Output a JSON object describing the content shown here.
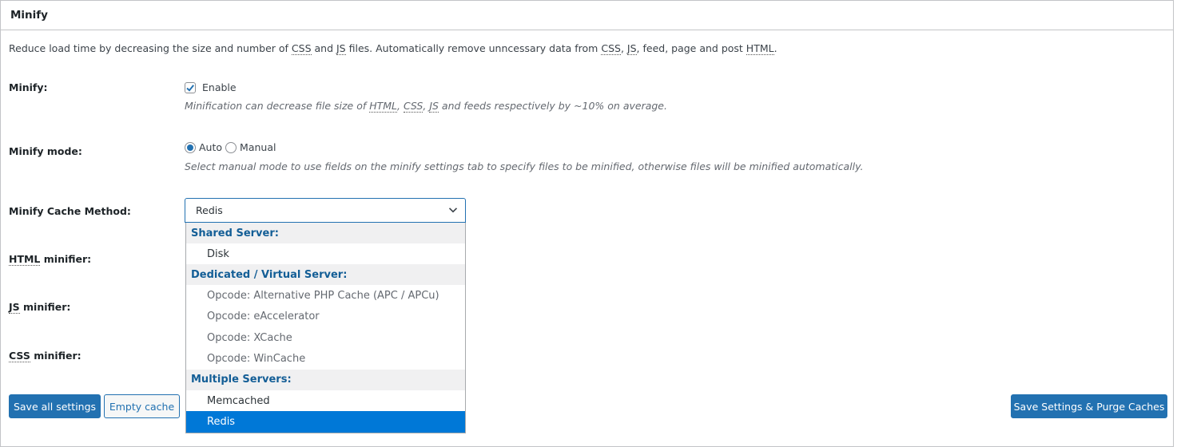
{
  "panel": {
    "title": "Minify"
  },
  "intro": {
    "part1": "Reduce load time by decreasing the size and number of ",
    "abbr_css": "CSS",
    "part2": " and ",
    "abbr_js": "JS",
    "part3": " files. Automatically remove unncessary data from ",
    "abbr_css2": "CSS",
    "part4": ", ",
    "abbr_js2": "JS",
    "part5": ", feed, page and post ",
    "abbr_html": "HTML",
    "part6": "."
  },
  "minify": {
    "label": "Minify:",
    "checkbox_label": "Enable",
    "checked": true,
    "desc_part1": "Minification can decrease file size of ",
    "abbr_html": "HTML",
    "sep1": ", ",
    "abbr_css": "CSS",
    "sep2": ", ",
    "abbr_js": "JS",
    "desc_part2": " and feeds respectively by ~10% on average."
  },
  "minify_mode": {
    "label": "Minify mode:",
    "options": [
      "Auto",
      "Manual"
    ],
    "selected": "Auto",
    "desc": "Select manual mode to use fields on the minify settings tab to specify files to be minified, otherwise files will be minified automatically."
  },
  "cache_method": {
    "label": "Minify Cache Method:",
    "selected": "Redis",
    "groups": [
      {
        "label": "Shared Server:",
        "options": [
          {
            "label": "Disk",
            "disabled": false
          }
        ]
      },
      {
        "label": "Dedicated / Virtual Server:",
        "options": [
          {
            "label": "Opcode: Alternative PHP Cache (APC / APCu)",
            "disabled": true
          },
          {
            "label": "Opcode: eAccelerator",
            "disabled": true
          },
          {
            "label": "Opcode: XCache",
            "disabled": true
          },
          {
            "label": "Opcode: WinCache",
            "disabled": true
          }
        ]
      },
      {
        "label": "Multiple Servers:",
        "options": [
          {
            "label": "Memcached",
            "disabled": false
          },
          {
            "label": "Redis",
            "disabled": false,
            "selected": true
          }
        ]
      }
    ]
  },
  "html_minifier": {
    "abbr": "HTML",
    "label": " minifier:"
  },
  "js_minifier": {
    "abbr": "JS",
    "label": " minifier:"
  },
  "css_minifier": {
    "abbr": "CSS",
    "label": " minifier:"
  },
  "buttons": {
    "save_all": "Save all settings",
    "empty_cache": "Empty cache",
    "save_purge": "Save Settings & Purge Caches"
  },
  "colors": {
    "primary": "#2271b1",
    "selected_option": "#0078d7",
    "group_label": "#135e96"
  }
}
